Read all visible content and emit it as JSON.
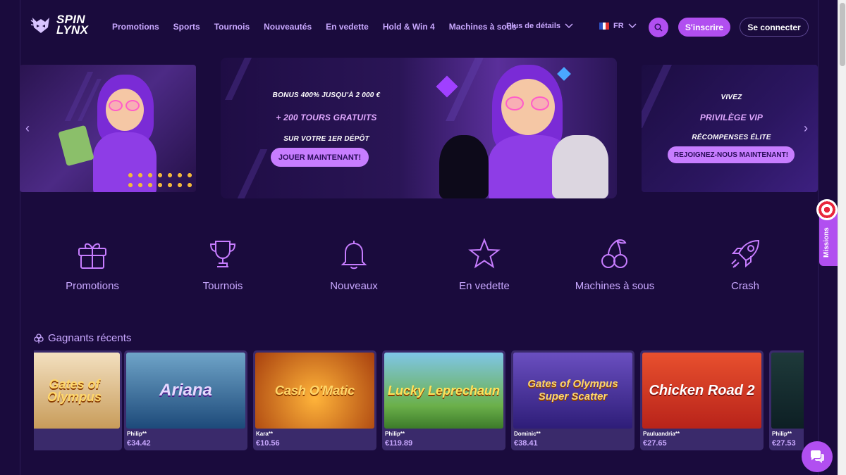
{
  "brand": {
    "line1": "SPIN",
    "line2": "LYNX"
  },
  "nav": {
    "items": [
      "Promotions",
      "Sports",
      "Tournois",
      "Nouveautés",
      "En vedette",
      "Hold & Win 4",
      "Machines à sous"
    ],
    "more_label": "Plus de détails",
    "lang": "FR",
    "signup": "S'inscrire",
    "login": "Se connecter"
  },
  "hero": {
    "main": {
      "line1": "BONUS 400% JUSQU'À 2 000 €",
      "line2": "+ 200 TOURS GRATUITS",
      "line3": "SUR VOTRE 1ER DÉPÔT",
      "cta": "JOUER MAINTENANT!"
    },
    "right": {
      "line1": "VIVEZ",
      "line2": "PRIVILÈGE VIP",
      "line3": "RÉCOMPENSES ÉLITE",
      "cta": "REJOIGNEZ-NOUS MAINTENANT!"
    }
  },
  "categories": [
    {
      "label": "Promotions",
      "icon": "gift-icon"
    },
    {
      "label": "Tournois",
      "icon": "trophy-icon"
    },
    {
      "label": "Nouveaux",
      "icon": "bell-icon"
    },
    {
      "label": "En vedette",
      "icon": "star-icon"
    },
    {
      "label": "Machines à sous",
      "icon": "cherries-icon"
    },
    {
      "label": "Crash",
      "icon": "rocket-icon"
    }
  ],
  "winners": {
    "title": "Gagnants récents",
    "cards": [
      {
        "game": "Gates of Olympus",
        "user": "",
        "amount": ""
      },
      {
        "game": "Ariana",
        "user": "Philip**",
        "amount": "€34.42"
      },
      {
        "game": "Cash O'Matic",
        "user": "Kara**",
        "amount": "€10.56"
      },
      {
        "game": "Lucky Leprechaun",
        "user": "Philip**",
        "amount": "€119.89"
      },
      {
        "game": "Gates of Olympus Super Scatter",
        "user": "Dominic**",
        "amount": "€38.41"
      },
      {
        "game": "Chicken Road 2",
        "user": "Pauluandria**",
        "amount": "€27.65"
      },
      {
        "game": "",
        "user": "Philip**",
        "amount": "€27.53"
      }
    ]
  },
  "missions_label": "Missions",
  "colors": {
    "bg": "#1a0b3d",
    "accent": "#b14ff0",
    "text_muted": "#c9a8ff"
  }
}
